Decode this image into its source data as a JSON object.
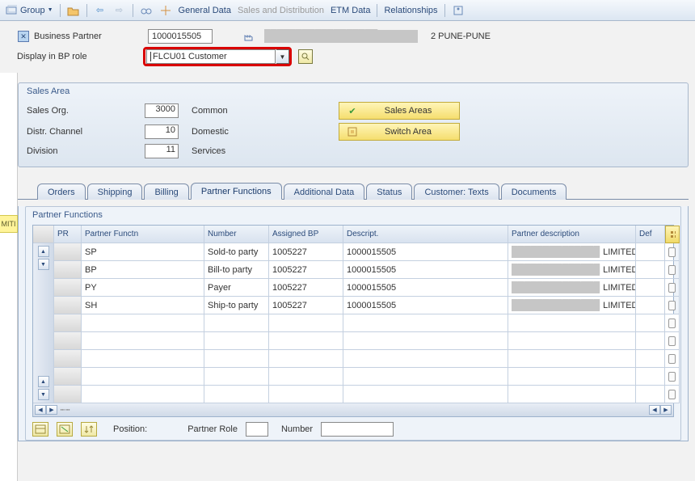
{
  "toolbar": {
    "group_label": "Group",
    "general_data": "General Data",
    "sales_dist": "Sales and Distribution",
    "etm_data": "ETM Data",
    "relationships": "Relationships"
  },
  "header": {
    "bp_label": "Business Partner",
    "bp_value": "1000015505",
    "addr_redacted": "██████████████████",
    "addr_suffix": "2 PUNE-PUNE",
    "role_label": "Display in BP role",
    "role_value": "FLCU01 Customer"
  },
  "sidebar": {
    "miti": "MITI"
  },
  "sales_area": {
    "title": "Sales Area",
    "org_label": "Sales Org.",
    "org_value": "3000",
    "org_desc": "Common",
    "dc_label": "Distr. Channel",
    "dc_value": "10",
    "dc_desc": "Domestic",
    "div_label": "Division",
    "div_value": "11",
    "div_desc": "Services",
    "btn_areas": "Sales Areas",
    "btn_switch": "Switch Area"
  },
  "tabs": {
    "orders": "Orders",
    "shipping": "Shipping",
    "billing": "Billing",
    "partner_functions": "Partner Functions",
    "additional_data": "Additional Data",
    "status": "Status",
    "customer_texts": "Customer: Texts",
    "documents": "Documents"
  },
  "panel": {
    "title": "Partner Functions"
  },
  "table": {
    "headers": {
      "pr": "PR",
      "func": "Partner Functn",
      "number": "Number",
      "assigned": "Assigned BP",
      "desc": "Descript.",
      "pdesc": "Partner description",
      "def": "Def"
    },
    "rows": [
      {
        "pr": "SP",
        "func": "Sold-to party",
        "number": "1005227",
        "assigned": "1000015505",
        "desc_redacted": "██████████████",
        "desc_suffix": "LIMITED",
        "pdesc": ""
      },
      {
        "pr": "BP",
        "func": "Bill-to party",
        "number": "1005227",
        "assigned": "1000015505",
        "desc_redacted": "██████████████",
        "desc_suffix": "LIMITED",
        "pdesc": ""
      },
      {
        "pr": "PY",
        "func": "Payer",
        "number": "1005227",
        "assigned": "1000015505",
        "desc_redacted": "██████████████",
        "desc_suffix": "LIMITED",
        "pdesc": ""
      },
      {
        "pr": "SH",
        "func": "Ship-to party",
        "number": "1005227",
        "assigned": "1000015505",
        "desc_redacted": "██████████████",
        "desc_suffix": "LIMITED",
        "pdesc": ""
      }
    ]
  },
  "footer": {
    "position": "Position:",
    "partner_role": "Partner Role",
    "number": "Number"
  }
}
